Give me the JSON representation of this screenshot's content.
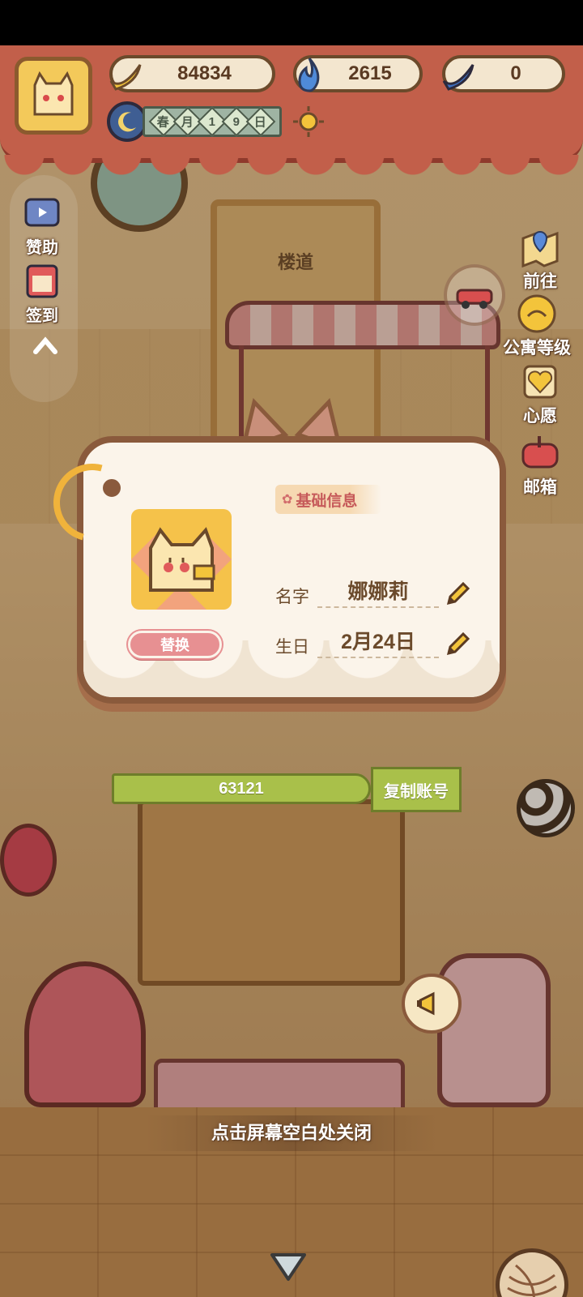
{
  "hud": {
    "currencies": [
      {
        "icon": "banana-icon",
        "value": "84834"
      },
      {
        "icon": "blue-flame-icon",
        "value": "2615"
      },
      {
        "icon": "blue-banana-icon",
        "value": "0"
      }
    ],
    "date": {
      "cells": [
        "春",
        "月",
        "1",
        "9",
        "日"
      ],
      "weather_icon": "sun-icon"
    }
  },
  "scene": {
    "door_sign": "楼道"
  },
  "left_menu": {
    "sponsor_label": "赞助",
    "checkin_label": "签到"
  },
  "right_menu": {
    "goto_label": "前往",
    "apartment_level_label": "公寓等级",
    "wish_label": "心愿",
    "mailbox_label": "邮箱"
  },
  "profile_card": {
    "section_title": "基础信息",
    "name_label": "名字",
    "name_value": "娜娜莉",
    "birthday_label": "生日",
    "birthday_value": "2月24日",
    "replace_button": "替换"
  },
  "account": {
    "id": "63121",
    "copy_button": "复制账号"
  },
  "close_hint": "点击屏幕空白处关闭",
  "colors": {
    "banner": "#c25f4a",
    "card_bg": "#fbf4ea",
    "card_border": "#8a5a3c",
    "accent_green": "#a9c04a",
    "replace_pink": "#e79092"
  }
}
